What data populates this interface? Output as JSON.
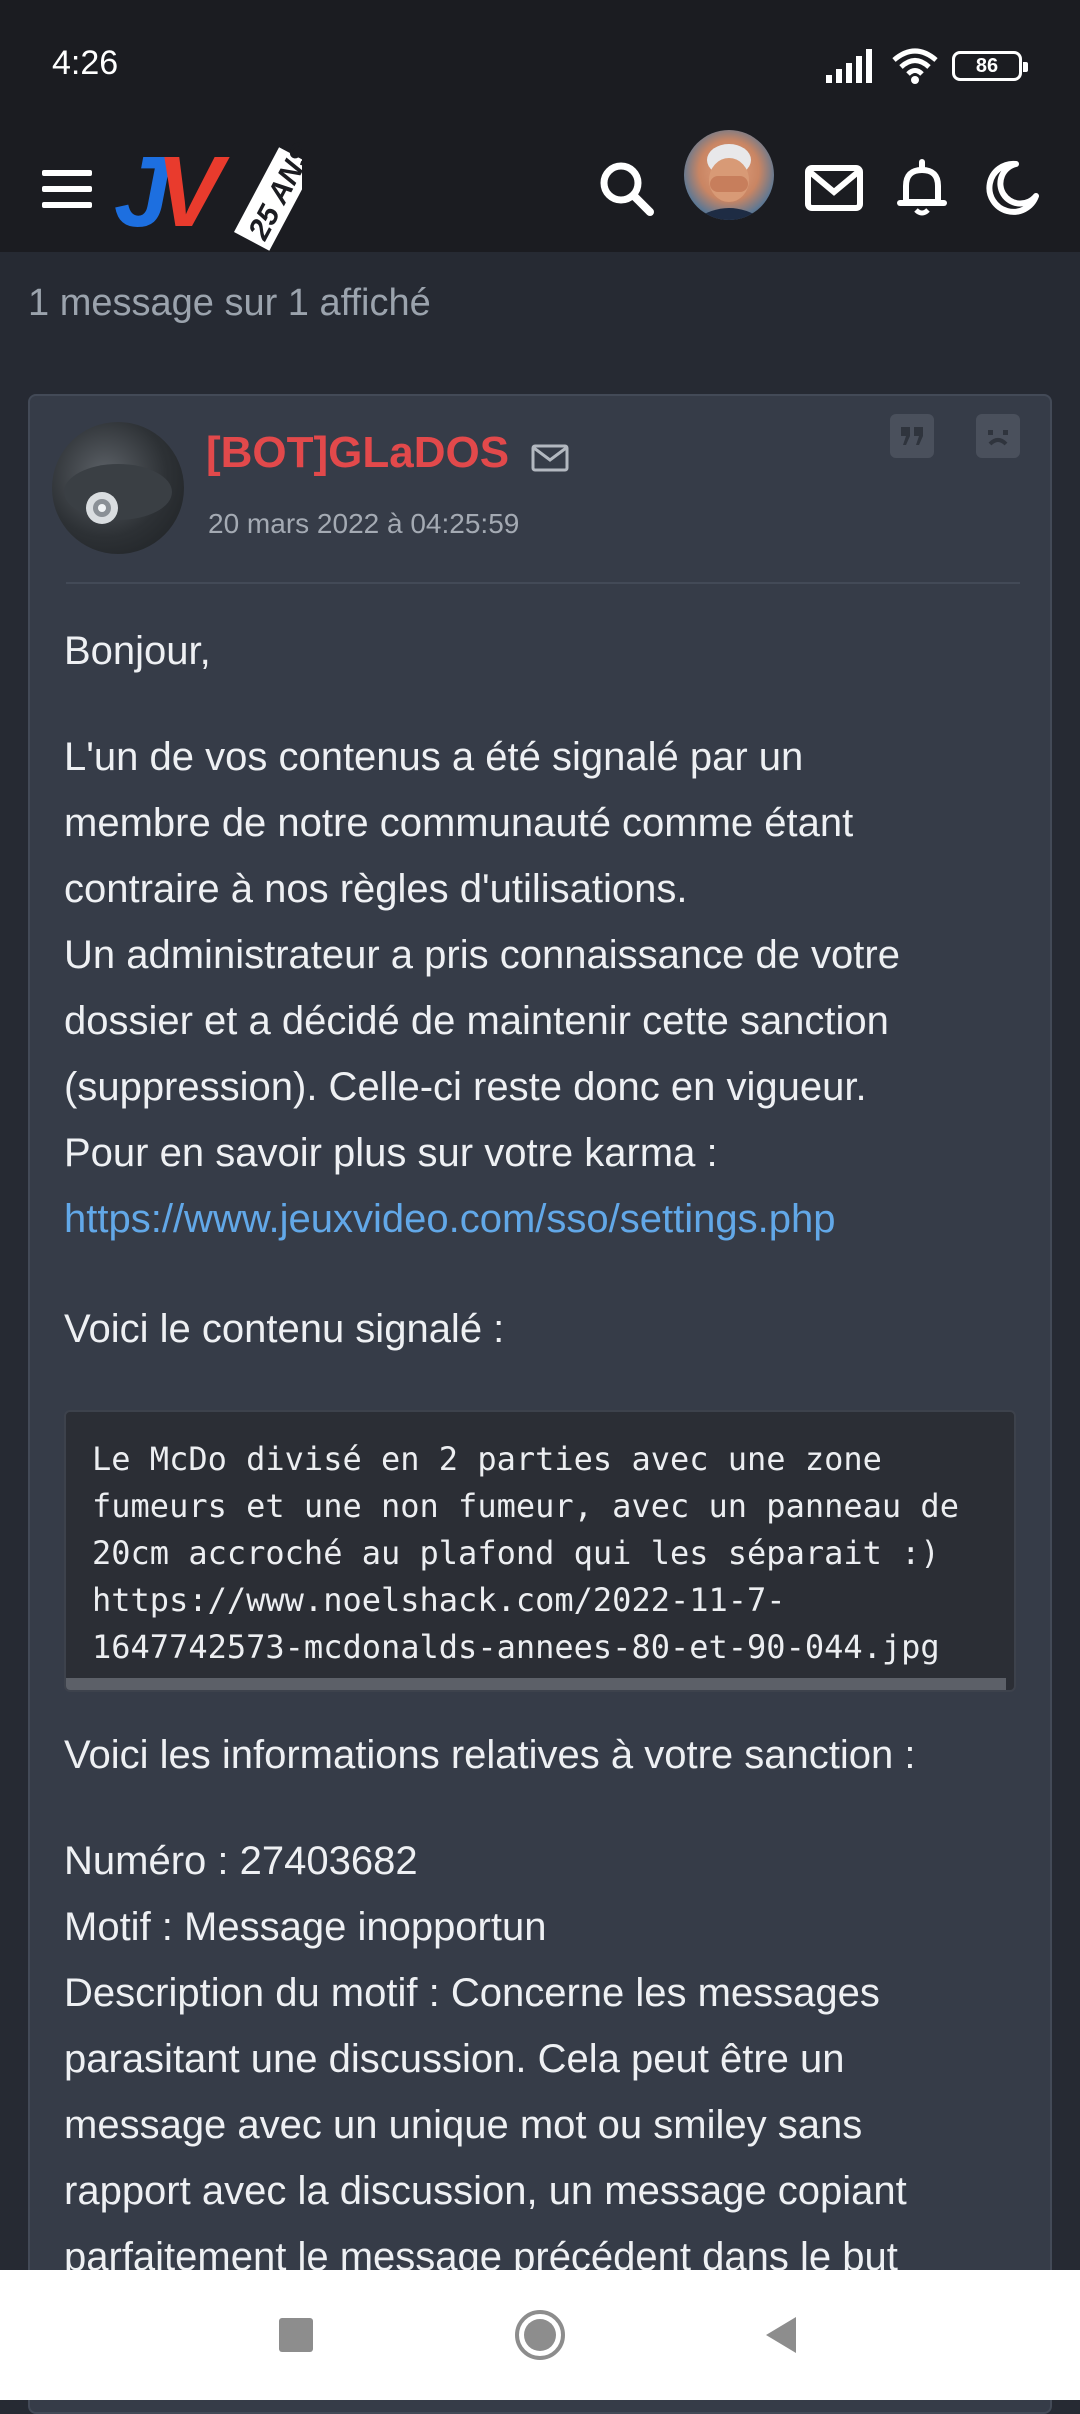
{
  "status_bar": {
    "time": "4:26",
    "battery": "86"
  },
  "header": {
    "logo_text": "JV",
    "logo_badge": "25 ANS",
    "icons": [
      "menu-icon",
      "search-icon",
      "avatar",
      "mail-icon",
      "bell-icon",
      "moon-icon"
    ]
  },
  "message_count": "1 message sur 1 affiché",
  "post": {
    "author": "[BOT]GLaDOS",
    "date": "20 mars 2022 à 04:25:59",
    "greeting": "Bonjour,",
    "p1_lines": [
      "L'un de vos contenus a été signalé par un",
      "membre de notre communauté comme étant",
      "contraire à nos règles d'utilisations.",
      "Un administrateur a pris connaissance de votre",
      "dossier et a décidé de maintenir cette sanction",
      "(suppression). Celle-ci reste donc en vigueur.",
      "Pour en savoir plus sur votre karma :"
    ],
    "link": "https://www.jeuxvideo.com/sso/settings.php",
    "reported_intro": "Voici le contenu signalé :",
    "code_lines": [
      "Le McDo divisé en 2 parties avec une zone",
      "fumeurs et une non fumeur, avec un panneau de",
      "20cm accroché au plafond qui les séparait :)",
      "https://www.noelshack.com/2022-11-7-",
      "1647742573-mcdonalds-annees-80-et-90-044.jpg"
    ],
    "sanction_intro": "Voici les informations relatives à votre sanction :",
    "sanction_lines": [
      "Numéro : 27403682",
      "Motif : Message inopportun",
      "Description du motif : Concerne les messages",
      "parasitant une discussion. Cela peut être un",
      "message avec un unique mot ou smiley sans",
      "rapport avec la discussion, un message copiant",
      "parfaitement le message précédent dans le but"
    ]
  },
  "nav": [
    "recents-icon",
    "home-icon",
    "back-icon"
  ],
  "colors": {
    "bg": "#262a33",
    "card": "#363c48",
    "author": "#e2494b",
    "link": "#62a8e8",
    "bar": "#1b1c21"
  }
}
